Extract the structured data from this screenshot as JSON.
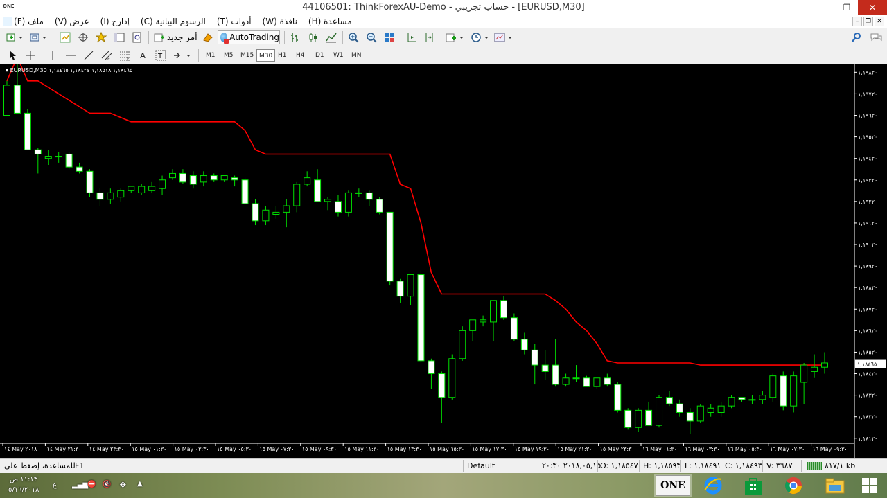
{
  "window": {
    "app_logo": "ONE",
    "title": "44106501: ThinkForexAU-Demo - حساب تجريبي - [EURUSD,M30]",
    "controls": {
      "minimize": "—",
      "restore": "❐",
      "close": "✕"
    }
  },
  "menu": {
    "items": [
      "ملف (F)",
      "عرض (V)",
      "إدارج (I)",
      "الرسوم البيانية (C)",
      "أدوات (T)",
      "نافذة (W)",
      "مساعدة (H)"
    ]
  },
  "toolbar": {
    "new_order_label": "أمر جديد",
    "autotrading_label": "AutoTrading",
    "timeframes": [
      "M1",
      "M5",
      "M15",
      "M30",
      "H1",
      "H4",
      "D1",
      "W1",
      "MN"
    ],
    "active_timeframe": "M30"
  },
  "chart": {
    "symbol_info": "EURUSD,M30  ١,١٨٤٦٥ ١,١٨٥١٨ ١,١٨٤٢٤ ١,١٨٤٦٥",
    "current_price_label": "١,١٨٤٦٥",
    "colors": {
      "background": "#000000",
      "candle_outline": "#00e000",
      "bull_body": "#000000",
      "bear_body": "#ffffff",
      "indicator": "#ff0000",
      "price_line": "#c0c0c0"
    }
  },
  "chart_data": {
    "type": "candlestick",
    "symbol": "EURUSD",
    "timeframe": "M30",
    "price_axis_labels": [
      "١,١٩٨٢٠",
      "١,١٩٧٢٠",
      "١,١٩٦٢٠",
      "١,١٩٥٢٠",
      "١,١٩٤٢٠",
      "١,١٩٣٢٠",
      "١,١٩٢٢٠",
      "١,١٩١٢٠",
      "١,١٩٠٢٠",
      "١,١٨٩٢٠",
      "١,١٨٨٢٠",
      "١,١٨٧٢٠",
      "١,١٨٦٢٠",
      "١,١٨٥٢٠",
      "١,١٨٤٢٠",
      "١,١٨٣٢٠",
      "١,١٨٢٢٠",
      "١,١٨١٢٠"
    ],
    "price_axis_values": [
      1.1982,
      1.1972,
      1.1962,
      1.1952,
      1.1942,
      1.1932,
      1.1922,
      1.1912,
      1.1902,
      1.1892,
      1.1882,
      1.1872,
      1.1862,
      1.1852,
      1.1842,
      1.1832,
      1.1822,
      1.1812
    ],
    "ylim": [
      1.181,
      1.1985
    ],
    "time_axis_labels": [
      "١٤ May ٢٠١٨",
      "١٤ May ٢١:٣٠",
      "١٤ May ٢٣:٣٠",
      "١٥ May ٠١:٣٠",
      "١٥ May ٠٣:٣٠",
      "١٥ May ٠٥:٣٠",
      "١٥ May ٠٧:٣٠",
      "١٥ May ٠٩:٣٠",
      "١٥ May ١١:٣٠",
      "١٥ May ١٣:٣٠",
      "١٥ May ١٥:٣٠",
      "١٥ May ١٧:٣٠",
      "١٥ May ١٩:٣٠",
      "١٥ May ٢١:٣٠",
      "١٥ May ٢٣:٣٠",
      "١٦ May ٠١:٣٠",
      "١٦ May ٠٣:٣٠",
      "١٦ May ٠٥:٣٠",
      "١٦ May ٠٧:٣٠",
      "١٦ May ٠٩:٣٠"
    ],
    "current_price": 1.18465,
    "candles": [
      {
        "o": 1.1962,
        "h": 1.1978,
        "l": 1.1962,
        "c": 1.1976
      },
      {
        "o": 1.1976,
        "h": 1.1992,
        "l": 1.1964,
        "c": 1.1963
      },
      {
        "o": 1.1963,
        "h": 1.1965,
        "l": 1.1946,
        "c": 1.1946
      },
      {
        "o": 1.1946,
        "h": 1.1947,
        "l": 1.1935,
        "c": 1.1944
      },
      {
        "o": 1.1942,
        "h": 1.1946,
        "l": 1.1939,
        "c": 1.1943
      },
      {
        "o": 1.1943,
        "h": 1.1945,
        "l": 1.194,
        "c": 1.1943
      },
      {
        "o": 1.1944,
        "h": 1.1945,
        "l": 1.1937,
        "c": 1.1938
      },
      {
        "o": 1.1938,
        "h": 1.194,
        "l": 1.1935,
        "c": 1.1936
      },
      {
        "o": 1.1936,
        "h": 1.1937,
        "l": 1.1924,
        "c": 1.1926
      },
      {
        "o": 1.1926,
        "h": 1.1928,
        "l": 1.192,
        "c": 1.1923
      },
      {
        "o": 1.1923,
        "h": 1.1928,
        "l": 1.1921,
        "c": 1.1926
      },
      {
        "o": 1.1924,
        "h": 1.1928,
        "l": 1.1922,
        "c": 1.1927
      },
      {
        "o": 1.1927,
        "h": 1.1929,
        "l": 1.1926,
        "c": 1.1929
      },
      {
        "o": 1.1926,
        "h": 1.193,
        "l": 1.1925,
        "c": 1.1929
      },
      {
        "o": 1.1927,
        "h": 1.1931,
        "l": 1.1926,
        "c": 1.1929
      },
      {
        "o": 1.1928,
        "h": 1.1934,
        "l": 1.1925,
        "c": 1.1932
      },
      {
        "o": 1.1933,
        "h": 1.1937,
        "l": 1.1932,
        "c": 1.1935
      },
      {
        "o": 1.1935,
        "h": 1.1937,
        "l": 1.193,
        "c": 1.1931
      },
      {
        "o": 1.1934,
        "h": 1.1936,
        "l": 1.1928,
        "c": 1.193
      },
      {
        "o": 1.1931,
        "h": 1.1936,
        "l": 1.1929,
        "c": 1.1934
      },
      {
        "o": 1.1934,
        "h": 1.1935,
        "l": 1.1931,
        "c": 1.1932
      },
      {
        "o": 1.1932,
        "h": 1.1934,
        "l": 1.1931,
        "c": 1.1934
      },
      {
        "o": 1.1933,
        "h": 1.1934,
        "l": 1.1929,
        "c": 1.1932
      },
      {
        "o": 1.1932,
        "h": 1.1933,
        "l": 1.1921,
        "c": 1.1921
      },
      {
        "o": 1.1921,
        "h": 1.1923,
        "l": 1.1911,
        "c": 1.1913
      },
      {
        "o": 1.1913,
        "h": 1.192,
        "l": 1.1911,
        "c": 1.1918
      },
      {
        "o": 1.1916,
        "h": 1.192,
        "l": 1.1914,
        "c": 1.1917
      },
      {
        "o": 1.1917,
        "h": 1.1923,
        "l": 1.191,
        "c": 1.192
      },
      {
        "o": 1.192,
        "h": 1.1931,
        "l": 1.1917,
        "c": 1.193
      },
      {
        "o": 1.193,
        "h": 1.1936,
        "l": 1.1929,
        "c": 1.1933
      },
      {
        "o": 1.1932,
        "h": 1.1937,
        "l": 1.1922,
        "c": 1.1922
      },
      {
        "o": 1.1922,
        "h": 1.1924,
        "l": 1.1918,
        "c": 1.1923
      },
      {
        "o": 1.1922,
        "h": 1.1925,
        "l": 1.1915,
        "c": 1.1917
      },
      {
        "o": 1.1917,
        "h": 1.1927,
        "l": 1.1915,
        "c": 1.1926
      },
      {
        "o": 1.1926,
        "h": 1.1928,
        "l": 1.1924,
        "c": 1.1926
      },
      {
        "o": 1.1926,
        "h": 1.1927,
        "l": 1.192,
        "c": 1.1923
      },
      {
        "o": 1.1923,
        "h": 1.1924,
        "l": 1.1916,
        "c": 1.1917
      },
      {
        "o": 1.1917,
        "h": 1.1917,
        "l": 1.1883,
        "c": 1.1885
      },
      {
        "o": 1.1885,
        "h": 1.1886,
        "l": 1.1875,
        "c": 1.1878
      },
      {
        "o": 1.1878,
        "h": 1.1888,
        "l": 1.1874,
        "c": 1.1888
      },
      {
        "o": 1.1888,
        "h": 1.189,
        "l": 1.1847,
        "c": 1.1848
      },
      {
        "o": 1.1848,
        "h": 1.1849,
        "l": 1.1835,
        "c": 1.1842
      },
      {
        "o": 1.1842,
        "h": 1.1843,
        "l": 1.1819,
        "c": 1.1831
      },
      {
        "o": 1.1831,
        "h": 1.1851,
        "l": 1.183,
        "c": 1.1849
      },
      {
        "o": 1.1849,
        "h": 1.1864,
        "l": 1.1848,
        "c": 1.1862
      },
      {
        "o": 1.1862,
        "h": 1.1867,
        "l": 1.1857,
        "c": 1.1867
      },
      {
        "o": 1.1866,
        "h": 1.1869,
        "l": 1.1864,
        "c": 1.1867
      },
      {
        "o": 1.1866,
        "h": 1.1876,
        "l": 1.1857,
        "c": 1.1876
      },
      {
        "o": 1.1876,
        "h": 1.1878,
        "l": 1.1867,
        "c": 1.1868
      },
      {
        "o": 1.1868,
        "h": 1.187,
        "l": 1.1857,
        "c": 1.1858
      },
      {
        "o": 1.1858,
        "h": 1.1861,
        "l": 1.1851,
        "c": 1.1853
      },
      {
        "o": 1.1853,
        "h": 1.1856,
        "l": 1.1837,
        "c": 1.1846
      },
      {
        "o": 1.1846,
        "h": 1.1853,
        "l": 1.1839,
        "c": 1.1843
      },
      {
        "o": 1.1846,
        "h": 1.1858,
        "l": 1.1836,
        "c": 1.1837
      },
      {
        "o": 1.1837,
        "h": 1.1842,
        "l": 1.1836,
        "c": 1.184
      },
      {
        "o": 1.184,
        "h": 1.1846,
        "l": 1.1838,
        "c": 1.184
      },
      {
        "o": 1.184,
        "h": 1.1841,
        "l": 1.1836,
        "c": 1.1836
      },
      {
        "o": 1.1836,
        "h": 1.184,
        "l": 1.1835,
        "c": 1.184
      },
      {
        "o": 1.184,
        "h": 1.1842,
        "l": 1.1836,
        "c": 1.1837
      },
      {
        "o": 1.1837,
        "h": 1.1838,
        "l": 1.1824,
        "c": 1.1825
      },
      {
        "o": 1.1825,
        "h": 1.1826,
        "l": 1.1816,
        "c": 1.1817
      },
      {
        "o": 1.1817,
        "h": 1.1826,
        "l": 1.1815,
        "c": 1.1825
      },
      {
        "o": 1.1825,
        "h": 1.1829,
        "l": 1.1818,
        "c": 1.1818
      },
      {
        "o": 1.1818,
        "h": 1.1832,
        "l": 1.1817,
        "c": 1.1831
      },
      {
        "o": 1.1831,
        "h": 1.1834,
        "l": 1.1827,
        "c": 1.1828
      },
      {
        "o": 1.1828,
        "h": 1.183,
        "l": 1.1822,
        "c": 1.1824
      },
      {
        "o": 1.1824,
        "h": 1.1826,
        "l": 1.1814,
        "c": 1.182
      },
      {
        "o": 1.182,
        "h": 1.1828,
        "l": 1.1819,
        "c": 1.1827
      },
      {
        "o": 1.1824,
        "h": 1.1828,
        "l": 1.1822,
        "c": 1.1826
      },
      {
        "o": 1.1824,
        "h": 1.1829,
        "l": 1.1822,
        "c": 1.1827
      },
      {
        "o": 1.1827,
        "h": 1.1832,
        "l": 1.1826,
        "c": 1.1831
      },
      {
        "o": 1.1831,
        "h": 1.1831,
        "l": 1.1829,
        "c": 1.183
      },
      {
        "o": 1.183,
        "h": 1.1832,
        "l": 1.1828,
        "c": 1.183
      },
      {
        "o": 1.183,
        "h": 1.1834,
        "l": 1.1828,
        "c": 1.1832
      },
      {
        "o": 1.1831,
        "h": 1.1842,
        "l": 1.1829,
        "c": 1.1841
      },
      {
        "o": 1.1841,
        "h": 1.1843,
        "l": 1.1825,
        "c": 1.1827
      },
      {
        "o": 1.1827,
        "h": 1.1843,
        "l": 1.1824,
        "c": 1.1841
      },
      {
        "o": 1.1838,
        "h": 1.1847,
        "l": 1.1828,
        "c": 1.1846
      },
      {
        "o": 1.1843,
        "h": 1.1851,
        "l": 1.184,
        "c": 1.1845
      },
      {
        "o": 1.1845,
        "h": 1.1852,
        "l": 1.1842,
        "c": 1.1847
      }
    ],
    "indicator_line": [
      1.1978,
      1.1989,
      1.1978,
      1.1978,
      1.1975,
      1.1972,
      1.1969,
      1.1966,
      1.1963,
      1.1963,
      1.1963,
      1.1961,
      1.1959,
      1.1959,
      1.1959,
      1.1959,
      1.1959,
      1.1959,
      1.1959,
      1.1959,
      1.1959,
      1.1959,
      1.1959,
      1.1955,
      1.1946,
      1.1944,
      1.1944,
      1.1944,
      1.1944,
      1.1944,
      1.1944,
      1.1944,
      1.1944,
      1.1944,
      1.1944,
      1.1944,
      1.1944,
      1.1944,
      1.193,
      1.1928,
      1.1912,
      1.1889,
      1.1879,
      1.1879,
      1.1879,
      1.1879,
      1.1879,
      1.1879,
      1.1879,
      1.1879,
      1.1879,
      1.1879,
      1.1879,
      1.1876,
      1.1872,
      1.1866,
      1.1862,
      1.1856,
      1.1848,
      1.1847,
      1.1847,
      1.1847,
      1.1847,
      1.1847,
      1.1847,
      1.1847,
      1.1847,
      1.1846,
      1.1846,
      1.1846,
      1.1846,
      1.1846,
      1.1846,
      1.1846,
      1.1846,
      1.1846,
      1.1846,
      1.1846,
      1.1846,
      1.1846
    ]
  },
  "statusbar": {
    "help_text": "للمساعدة، إضغط على",
    "help_key": "F1",
    "profile": "Default",
    "datetime": "٢٠١٨,٠٥,١٥ ٢٠:٣٠",
    "open": "O: ١,١٨٥٤٧",
    "high": "H: ١,١٨٥٩٣",
    "low": "L: ١,١٨٤٩١",
    "close": "C: ١,١٨٤٩٣",
    "volume": "V: ٣٦٨٧",
    "traffic": "٨١٧/١ kb"
  },
  "taskbar": {
    "clock_time": "١١:١٣ ص",
    "clock_date": "٥/١٦/٢٠١٨",
    "lang": "ع",
    "pinned": [
      "ONE",
      "internet-explorer",
      "store",
      "chrome",
      "file-explorer"
    ]
  }
}
